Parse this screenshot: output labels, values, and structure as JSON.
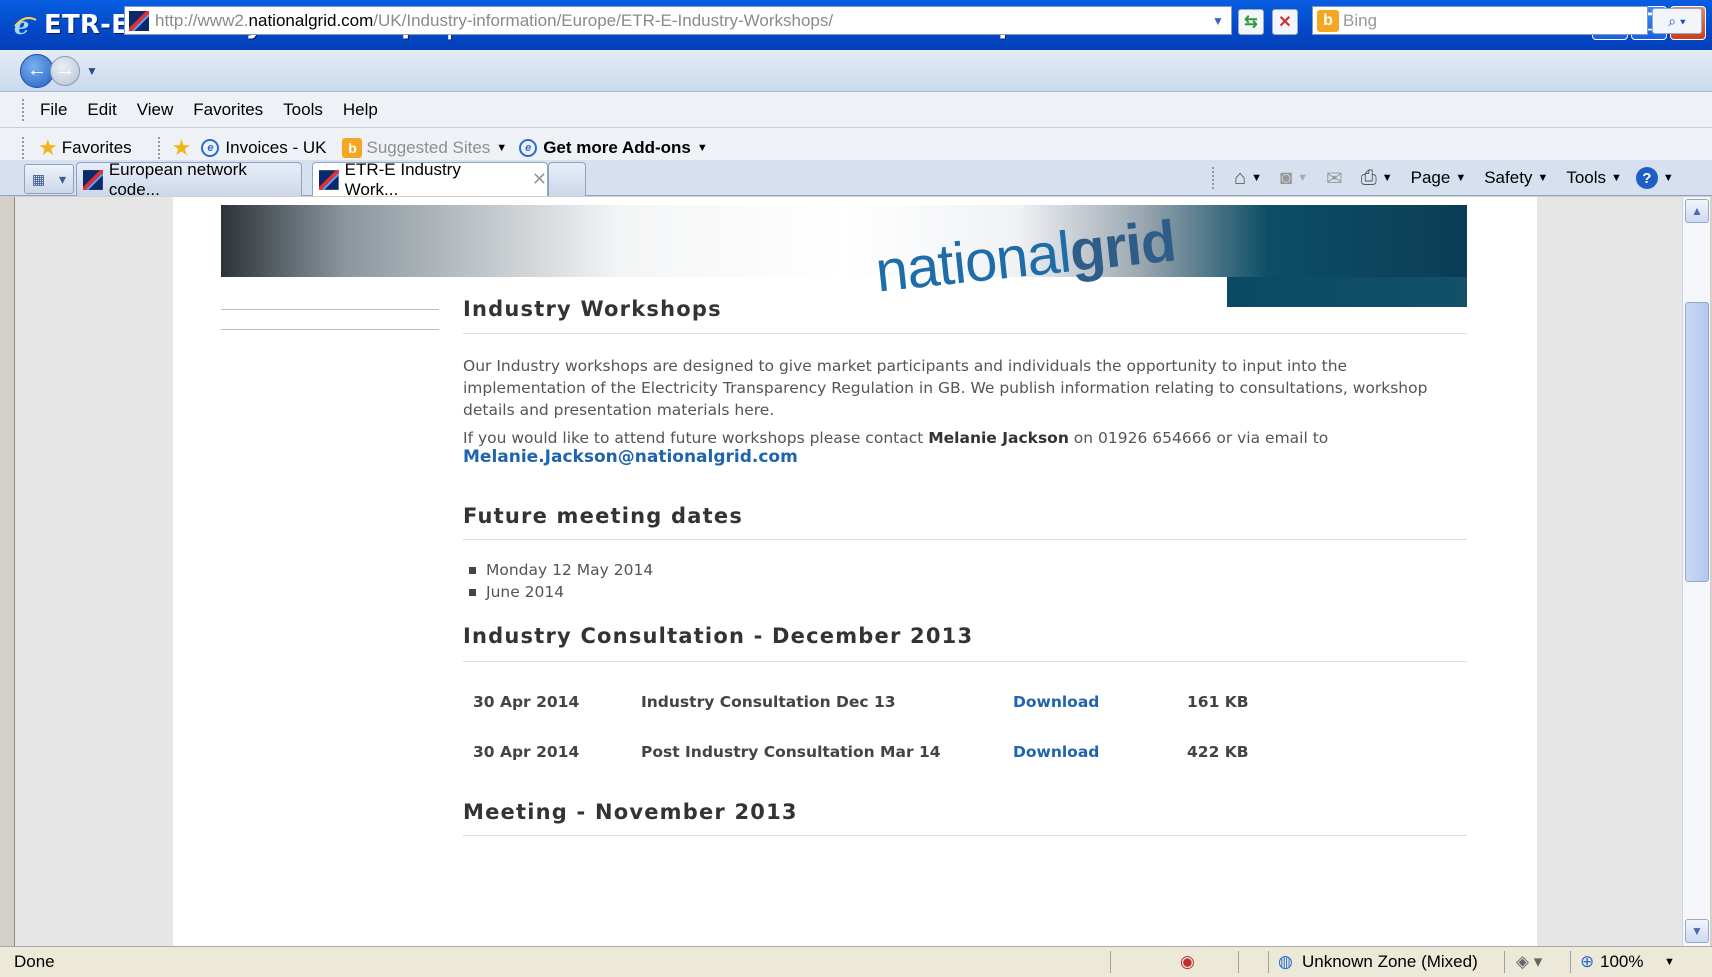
{
  "window": {
    "title": "ETR-E Industry Workshops | National Grid - Windows Internet Explorer"
  },
  "address": {
    "url_prefix": "http://www2.",
    "url_domain": "nationalgrid.com",
    "url_path": "/UK/Industry-information/Europe/ETR-E-Industry-Workshops/",
    "search_placeholder": "Bing"
  },
  "menu": [
    "File",
    "Edit",
    "View",
    "Favorites",
    "Tools",
    "Help"
  ],
  "favorites": {
    "favorites_label": "Favorites",
    "items": [
      "Invoices - UK",
      "Suggested Sites",
      "Get more Add-ons"
    ]
  },
  "tabs": [
    {
      "label": "European network code...",
      "active": false
    },
    {
      "label": "ETR-E Industry Work...",
      "active": true
    }
  ],
  "commands": {
    "page": "Page",
    "safety": "Safety",
    "tools": "Tools"
  },
  "banner": {
    "brand_light": "national",
    "brand_bold": "grid"
  },
  "content": {
    "heading_workshops": "Industry Workshops",
    "intro": "Our Industry workshops are designed to give market participants and individuals the opportunity to input into the implementation of the Electricity Transparency  Regulation in GB. We publish information relating to consultations, workshop details and presentation materials here.",
    "contact_prefix": "If you would like to attend future workshops please contact ",
    "contact_name": "Melanie Jackson",
    "contact_suffix": " on 01926 654666 or via email to",
    "email": "Melanie.Jackson@nationalgrid.com",
    "heading_future": "Future meeting dates",
    "dates": [
      "Monday 12 May 2014",
      "June 2014"
    ],
    "heading_consultation": "Industry Consultation - December 2013",
    "documents": [
      {
        "date": "30 Apr 2014",
        "title": "Industry Consultation Dec 13",
        "action": "Download",
        "size": "161 KB"
      },
      {
        "date": "30 Apr 2014",
        "title": "Post Industry Consultation Mar 14",
        "action": "Download",
        "size": "422 KB"
      }
    ],
    "heading_meeting": "Meeting - November 2013"
  },
  "status": {
    "text": "Done",
    "zone": "Unknown Zone (Mixed)",
    "zoom": "100%"
  }
}
